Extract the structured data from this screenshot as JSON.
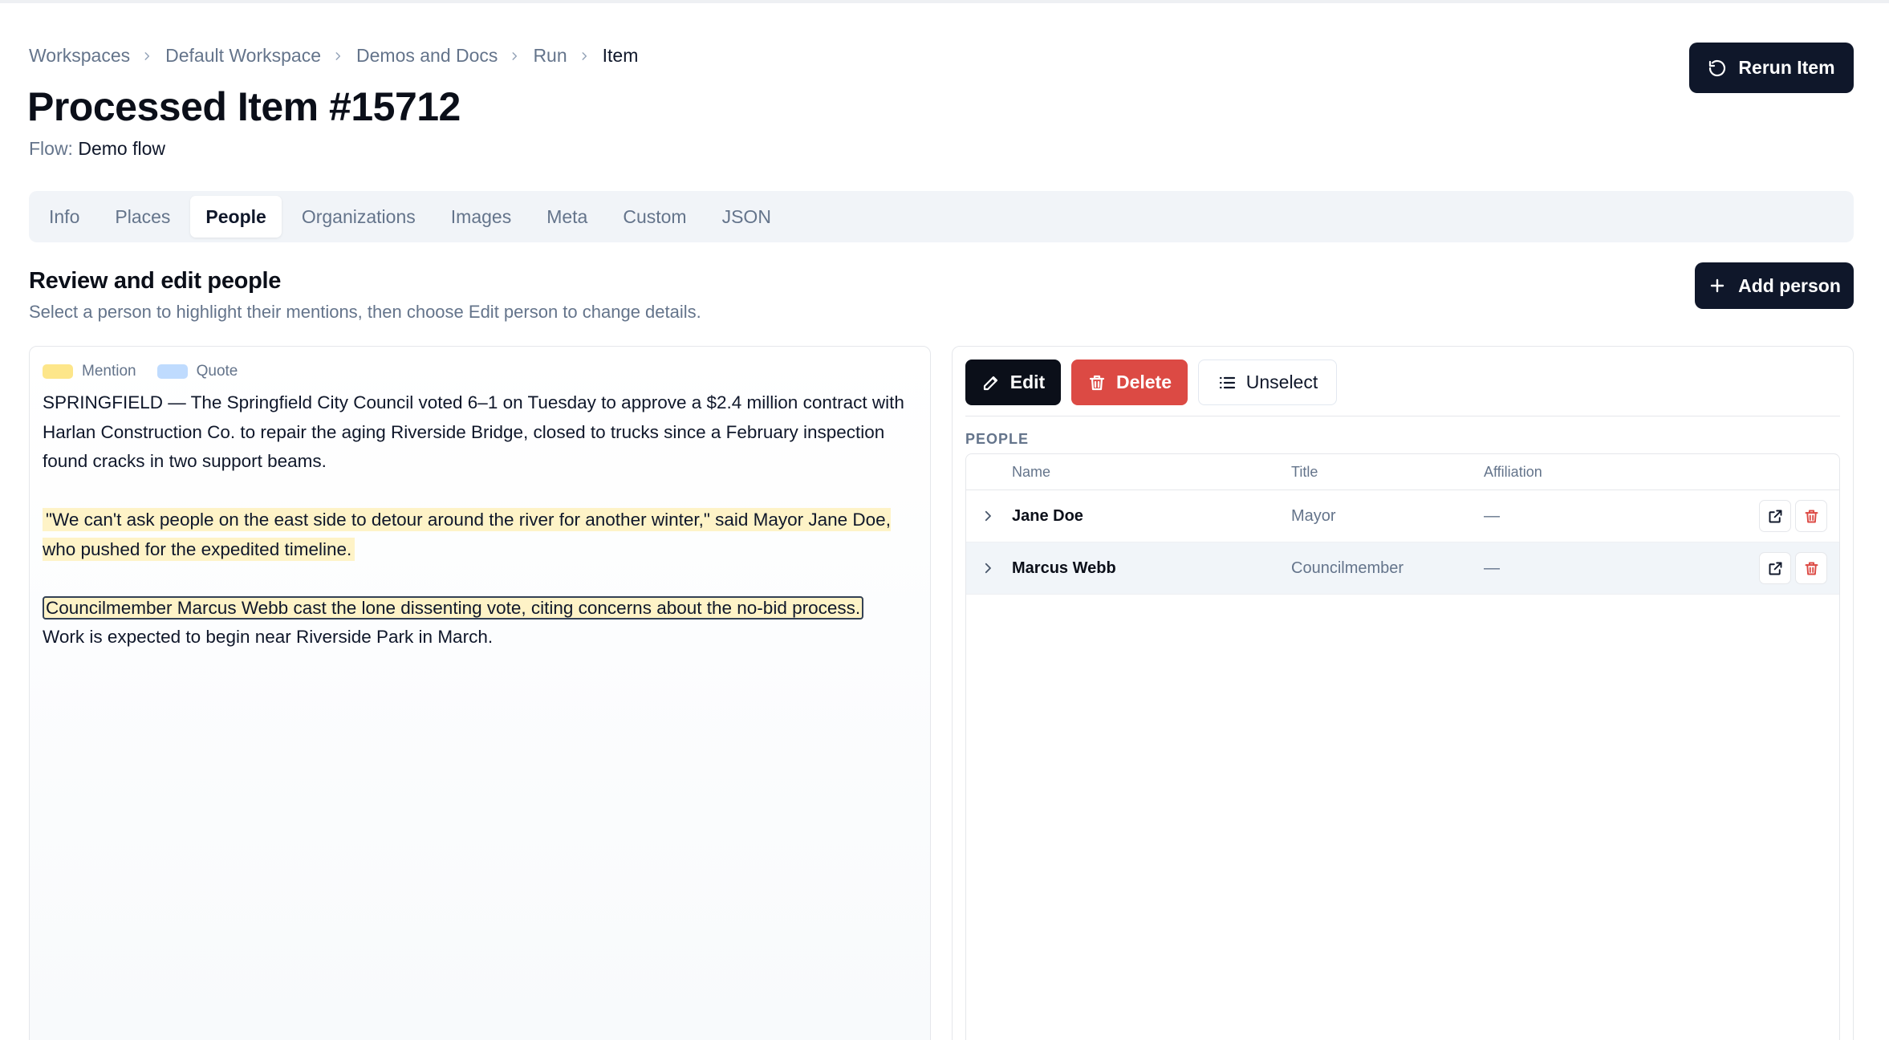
{
  "breadcrumb": [
    "Workspaces",
    "Default Workspace",
    "Demos and Docs",
    "Run",
    "Item"
  ],
  "header": {
    "title": "Processed Item #15712",
    "flow_label": "Flow:",
    "flow_value": "Demo flow",
    "rerun_label": "Rerun Item"
  },
  "tabs": [
    "Info",
    "Places",
    "People",
    "Organizations",
    "Images",
    "Meta",
    "Custom",
    "JSON"
  ],
  "active_tab": "People",
  "section": {
    "title": "Review and edit people",
    "subtitle": "Select a person to highlight their mentions, then choose Edit person to change details.",
    "add_label": "Add person"
  },
  "legend": {
    "mention": "Mention",
    "quote": "Quote"
  },
  "legend_colors": {
    "mention": "#fde68a",
    "quote": "#bfdbfe"
  },
  "article": {
    "p1": "SPRINGFIELD — The Springfield City Council voted 6–1 on Tuesday to approve a $2.4 million contract with Harlan Construction Co. to repair the aging Riverside Bridge, closed to trucks since a February inspection found cracks in two support beams.",
    "p2": "\"We can't ask people on the east side to detour around the river for another winter,\" said Mayor Jane Doe, who pushed for the expedited timeline.",
    "p3_selected": "Councilmember Marcus Webb cast the lone dissenting vote, citing concerns about the no-bid process.",
    "p3_rest": "Work is expected to begin near Riverside Park in March."
  },
  "actions": {
    "edit": "Edit",
    "delete": "Delete",
    "unselect": "Unselect"
  },
  "people": {
    "label": "PEOPLE",
    "columns": {
      "name": "Name",
      "title": "Title",
      "affiliation": "Affiliation"
    },
    "rows": [
      {
        "name": "Jane Doe",
        "title": "Mayor",
        "affiliation": "—",
        "selected": false
      },
      {
        "name": "Marcus Webb",
        "title": "Councilmember",
        "affiliation": "—",
        "selected": true
      }
    ]
  },
  "colors": {
    "primary_dark": "#0f172a",
    "danger": "#dc4a44",
    "highlight": "#fef3c7"
  }
}
